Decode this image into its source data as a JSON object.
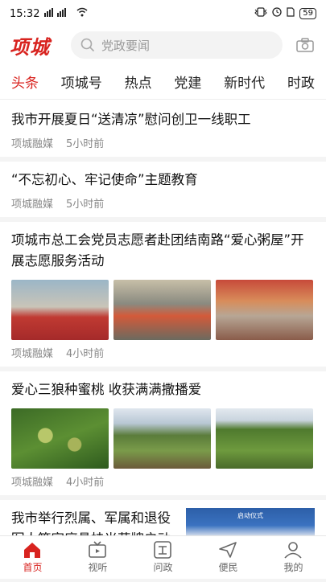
{
  "status": {
    "time": "15:32",
    "battery": "59"
  },
  "header": {
    "logo": "项城",
    "search_placeholder": "党政要闻"
  },
  "tabs": [
    "头条",
    "项城号",
    "热点",
    "党建",
    "新时代",
    "时政"
  ],
  "news": [
    {
      "title": "我市开展夏日“送清凉”慰问创卫一线职工",
      "source": "项城融媒",
      "time": "5小时前"
    },
    {
      "title": "“不忘初心、牢记使命”主题教育",
      "source": "项城融媒",
      "time": "5小时前"
    },
    {
      "title": "项城市总工会党员志愿者赴团结南路“爱心粥屋”开展志愿服务活动",
      "source": "项城融媒",
      "time": "4小时前"
    },
    {
      "title": "爱心三狼种蜜桃 收获满满撒播爱",
      "source": "项城融媒",
      "time": "4小时前"
    },
    {
      "title": "我市举行烈属、军属和退役军人等家庭悬挂光荣牌启动仪式",
      "image_caption": "启动仪式"
    }
  ],
  "bottom_nav": [
    "首页",
    "视听",
    "问政",
    "便民",
    "我的"
  ],
  "colors": {
    "accent": "#d8231f"
  }
}
